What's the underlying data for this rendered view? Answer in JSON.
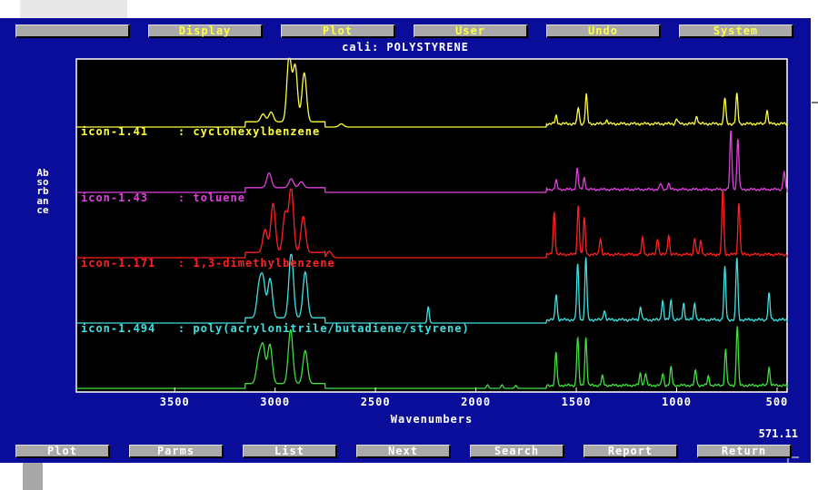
{
  "menu": [
    "",
    "Display",
    "Plot",
    "User",
    "Undo",
    "System"
  ],
  "title": "cali: POLYSTYRENE",
  "y_axis_label": "Absorbance",
  "x_axis_label": "Wavenumbers",
  "cursor_value": "571.11",
  "bottom_buttons": [
    "Plot",
    "Parms",
    "List",
    "Next",
    "Search",
    "Report",
    "Return"
  ],
  "colors": {
    "screen_bg": "#0a0c9a",
    "plot_bg": "#000000",
    "button": "#a9a9a9",
    "menu_text": "#ffff44",
    "button_text": "#ffffff"
  },
  "chart_data": {
    "type": "line",
    "title": "cali: POLYSTYRENE",
    "xlabel": "Wavenumbers",
    "ylabel": "Absorbance",
    "xlim": [
      3990,
      450
    ],
    "x_ticks": [
      3500,
      3000,
      2500,
      2000,
      1500,
      1000,
      500
    ],
    "series": [
      {
        "name": "icon-1.41 : cyclohexylbenzene",
        "color": "#ffff40",
        "peaks": [
          [
            3060,
            0.12
          ],
          [
            3020,
            0.15
          ],
          [
            2930,
            1.0
          ],
          [
            2900,
            0.85
          ],
          [
            2855,
            0.75
          ],
          [
            2670,
            0.05
          ],
          [
            1600,
            0.12
          ],
          [
            1490,
            0.25
          ],
          [
            1450,
            0.45
          ],
          [
            1350,
            0.06
          ],
          [
            1000,
            0.08
          ],
          [
            900,
            0.12
          ],
          [
            760,
            0.4
          ],
          [
            700,
            0.45
          ],
          [
            550,
            0.2
          ]
        ]
      },
      {
        "name": "icon-1.43 : toluene",
        "color": "#e040e0",
        "peaks": [
          [
            3030,
            0.25
          ],
          [
            2920,
            0.15
          ],
          [
            2870,
            0.1
          ],
          [
            1600,
            0.15
          ],
          [
            1495,
            0.35
          ],
          [
            1460,
            0.2
          ],
          [
            1080,
            0.1
          ],
          [
            1040,
            0.1
          ],
          [
            730,
            1.0
          ],
          [
            695,
            0.85
          ],
          [
            465,
            0.3
          ]
        ]
      },
      {
        "name": "icon-1.171 : 1,3-dimethylbenzene",
        "color": "#ff2020",
        "peaks": [
          [
            3050,
            0.35
          ],
          [
            3010,
            0.75
          ],
          [
            2950,
            0.6
          ],
          [
            2920,
            1.0
          ],
          [
            2860,
            0.55
          ],
          [
            2730,
            0.1
          ],
          [
            1610,
            0.65
          ],
          [
            1490,
            0.75
          ],
          [
            1460,
            0.55
          ],
          [
            1380,
            0.25
          ],
          [
            1170,
            0.25
          ],
          [
            1095,
            0.25
          ],
          [
            1040,
            0.3
          ],
          [
            910,
            0.25
          ],
          [
            880,
            0.2
          ],
          [
            770,
            1.0
          ],
          [
            690,
            0.8
          ]
        ]
      },
      {
        "name": "icon-1.494 : poly(acrylonitrile/butadiene/styrene)",
        "color": "#40e0e0",
        "peaks": [
          [
            3080,
            0.45
          ],
          [
            3060,
            0.55
          ],
          [
            3025,
            0.6
          ],
          [
            2920,
            1.0
          ],
          [
            2850,
            0.7
          ],
          [
            2237,
            0.25
          ],
          [
            1600,
            0.4
          ],
          [
            1493,
            0.85
          ],
          [
            1452,
            0.95
          ],
          [
            1360,
            0.15
          ],
          [
            1180,
            0.2
          ],
          [
            1070,
            0.3
          ],
          [
            1028,
            0.3
          ],
          [
            965,
            0.25
          ],
          [
            910,
            0.25
          ],
          [
            760,
            0.8
          ],
          [
            700,
            0.95
          ],
          [
            540,
            0.4
          ]
        ]
      },
      {
        "name": "",
        "color": "#40e040",
        "peaks": [
          [
            3082,
            0.4
          ],
          [
            3060,
            0.6
          ],
          [
            3026,
            0.65
          ],
          [
            2923,
            0.9
          ],
          [
            2850,
            0.55
          ],
          [
            1942,
            0.06
          ],
          [
            1870,
            0.06
          ],
          [
            1801,
            0.05
          ],
          [
            1601,
            0.55
          ],
          [
            1493,
            0.8
          ],
          [
            1452,
            0.8
          ],
          [
            1370,
            0.15
          ],
          [
            1181,
            0.2
          ],
          [
            1155,
            0.2
          ],
          [
            1069,
            0.2
          ],
          [
            1028,
            0.3
          ],
          [
            906,
            0.25
          ],
          [
            842,
            0.15
          ],
          [
            756,
            0.6
          ],
          [
            698,
            1.0
          ],
          [
            540,
            0.3
          ]
        ]
      }
    ]
  }
}
